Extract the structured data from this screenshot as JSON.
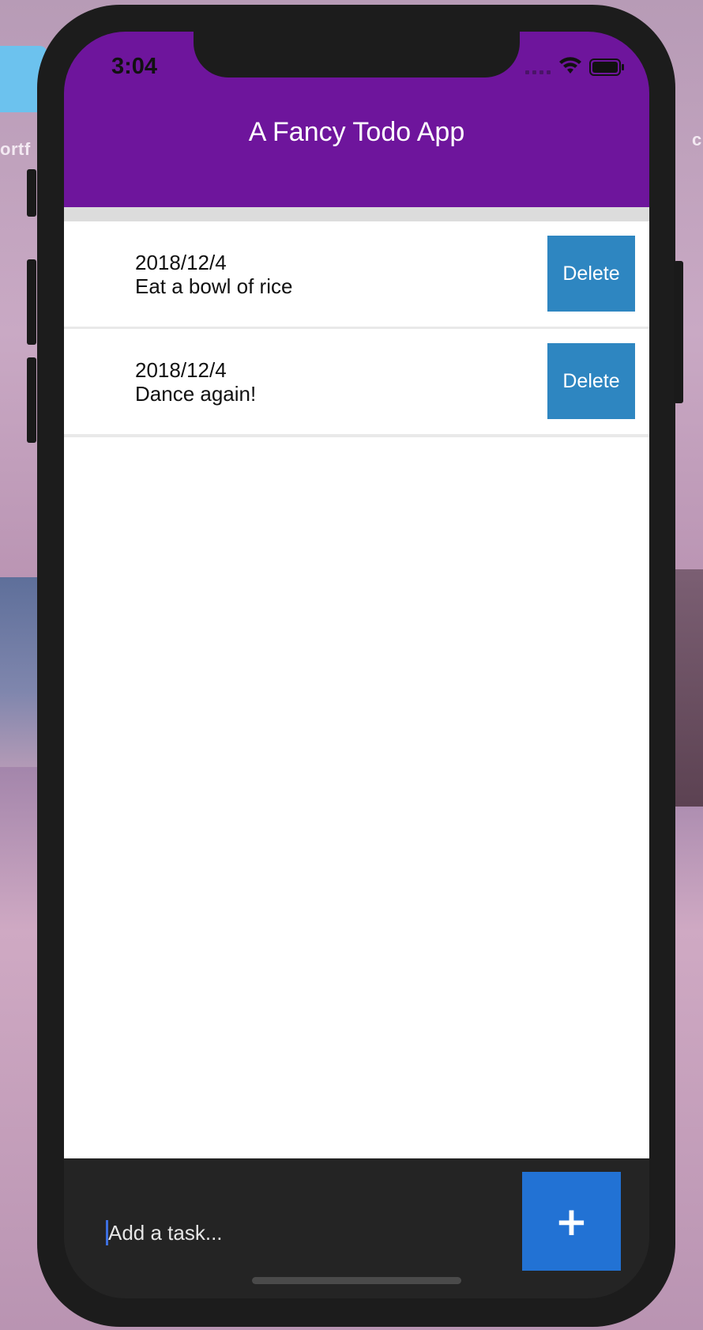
{
  "background": {
    "left_label": "ortf",
    "right_label": "c"
  },
  "status_bar": {
    "time": "3:04",
    "icons": [
      "cellular-signal-icon",
      "wifi-icon",
      "battery-icon"
    ]
  },
  "header": {
    "title": "A Fancy Todo App",
    "color": "#6e159c"
  },
  "todos": [
    {
      "date": "2018/12/4",
      "text": "Eat a bowl of rice",
      "delete_label": "Delete"
    },
    {
      "date": "2018/12/4",
      "text": "Dance again!",
      "delete_label": "Delete"
    }
  ],
  "composer": {
    "placeholder": "Add a task...",
    "value": "",
    "add_label": "+"
  },
  "colors": {
    "delete_button": "#2e86c1",
    "add_button": "#2272d4",
    "bottom_bar": "#242424"
  }
}
